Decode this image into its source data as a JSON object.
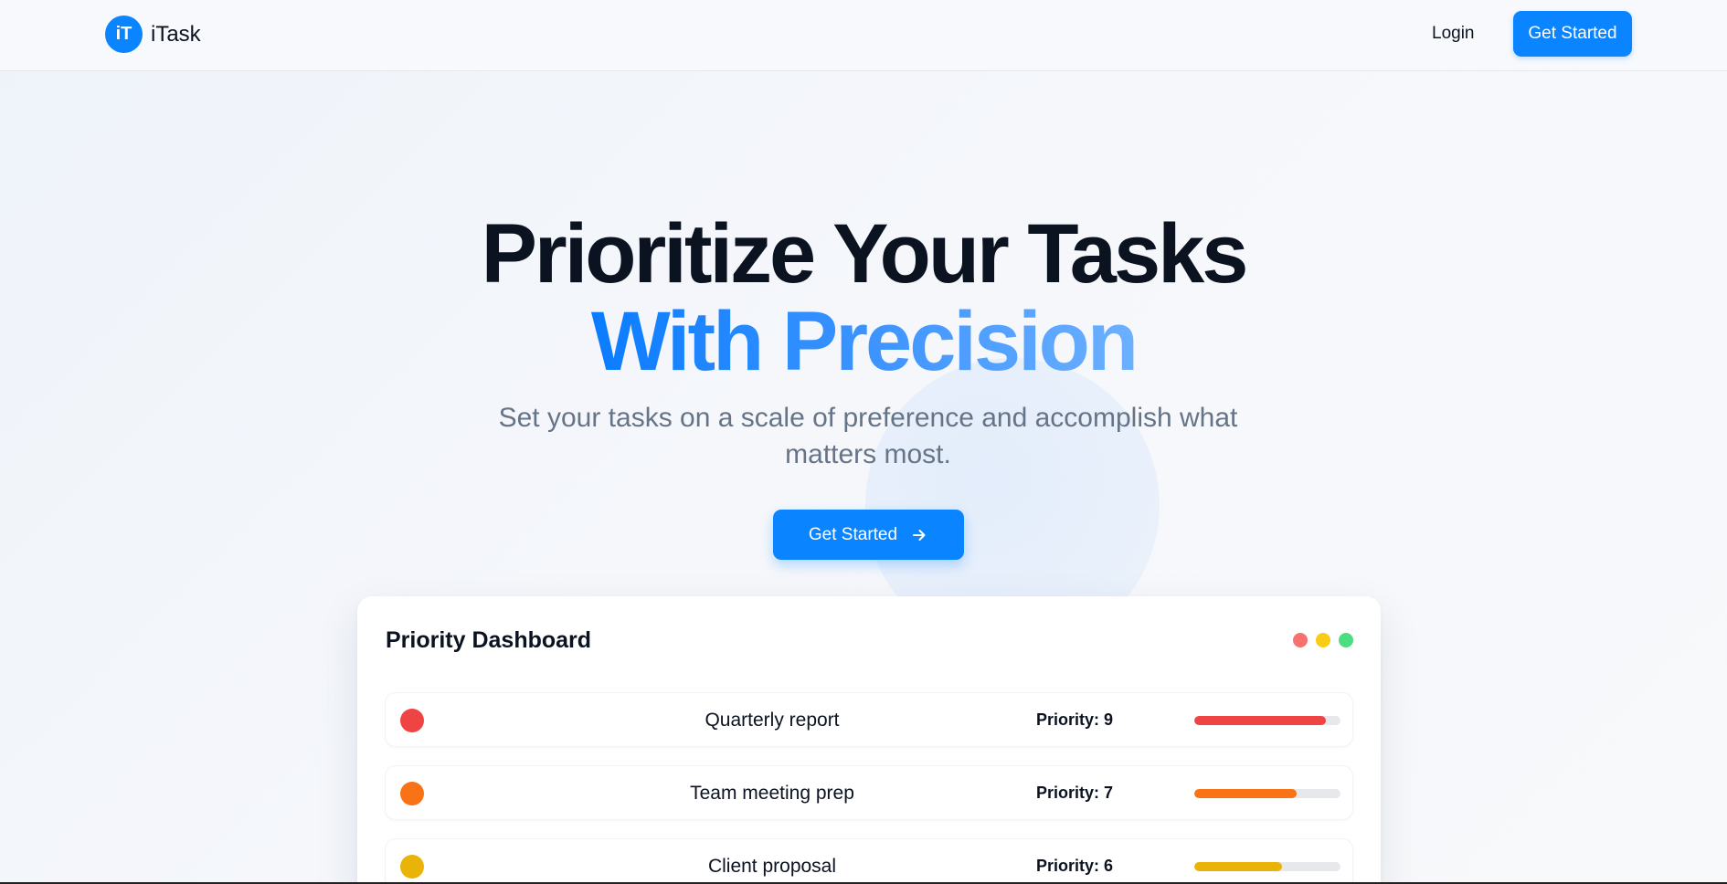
{
  "navbar": {
    "logo_badge": "iT",
    "brand": "iTask",
    "login_label": "Login",
    "cta_label": "Get Started"
  },
  "hero": {
    "title_line1": "Prioritize Your Tasks",
    "title_line2": "With Precision",
    "subtitle": "Set your tasks on a scale of preference and accomplish what matters most.",
    "cta_label": "Get Started",
    "cta_icon": "arrow-right-icon"
  },
  "dashboard": {
    "title": "Priority Dashboard",
    "window_dots": [
      "#f87171",
      "#facc15",
      "#4ade80"
    ],
    "tasks": [
      {
        "label": "Quarterly report",
        "priority_text": "Priority: 9",
        "priority": 9,
        "color": "#ef4444"
      },
      {
        "label": "Team meeting prep",
        "priority_text": "Priority: 7",
        "priority": 7,
        "color": "#f97316"
      },
      {
        "label": "Client proposal",
        "priority_text": "Priority: 6",
        "priority": 6,
        "color": "#eab308"
      }
    ],
    "priority_max": 10
  },
  "colors": {
    "accent": "#0a84ff",
    "text": "#0b1220",
    "muted": "#667487"
  }
}
